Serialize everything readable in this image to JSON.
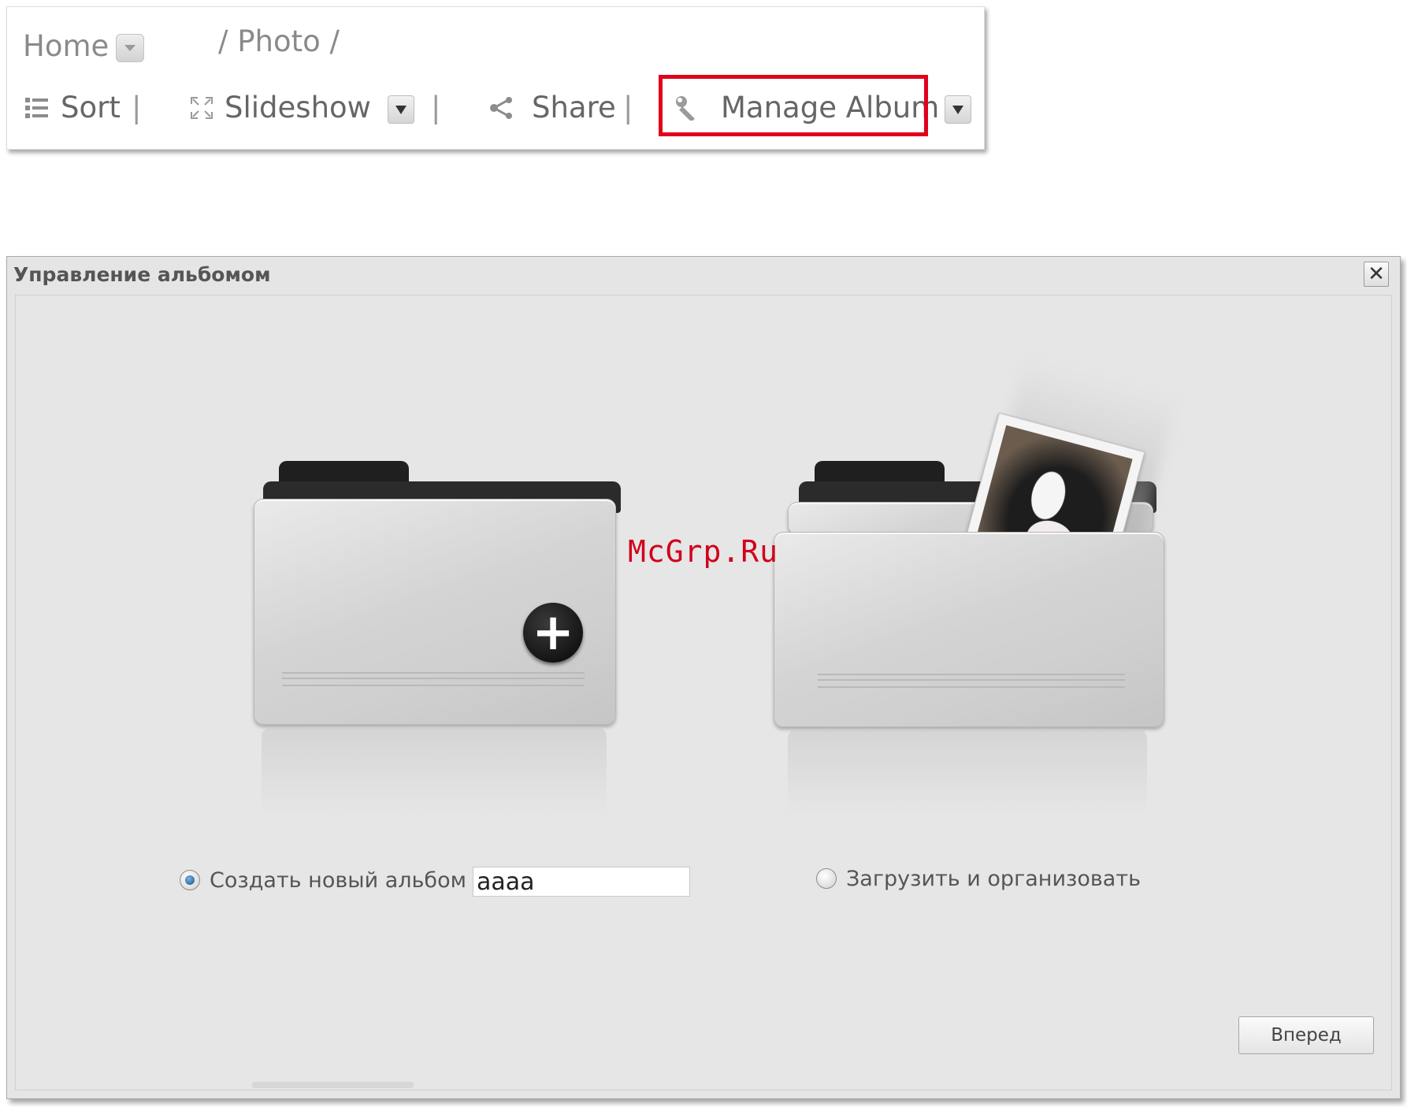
{
  "toolbar": {
    "breadcrumb_home": "Home",
    "breadcrumb_path": "/ Photo /",
    "sort_label": "Sort",
    "slideshow_label": "Slideshow",
    "share_label": "Share",
    "manage_album_label": "Manage Album",
    "separator": "|",
    "highlight_color": "#e0001b"
  },
  "dialog": {
    "title": "Управление альбомом",
    "close_glyph": "✕",
    "options": {
      "create_new_label": "Создать новый альбом",
      "create_new_selected": true,
      "album_name_value": "aaaa",
      "upload_organize_label": "Загрузить и организовать",
      "upload_organize_selected": false
    },
    "next_button_label": "Вперед"
  },
  "watermark": "McGrp.Ru",
  "icons": {
    "sort": "list-icon",
    "slideshow": "expand-icon",
    "share": "share-icon",
    "manage_album": "wrench-icon",
    "new_album": "folder-plus-icon",
    "upload": "folder-photo-icon"
  }
}
